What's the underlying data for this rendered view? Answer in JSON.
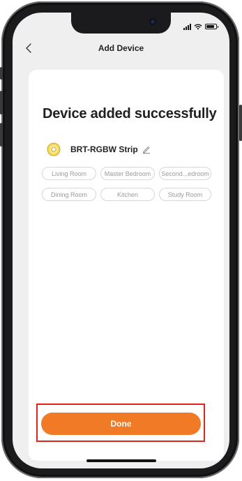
{
  "header": {
    "title": "Add Device",
    "back_icon": "chevron-left-icon"
  },
  "status_bar": {
    "icons": [
      "signal-icon",
      "wifi-icon",
      "battery-icon"
    ]
  },
  "main": {
    "headline": "Device added successfully",
    "device": {
      "name": "BRT-RGBW Strip",
      "icon": "light-strip-icon",
      "edit_icon": "pencil-icon"
    },
    "rooms": [
      "Living Room",
      "Master Bedroom",
      "Second...edroom",
      "Dining Room",
      "Kitchen",
      "Study Room"
    ]
  },
  "footer": {
    "done_label": "Done"
  },
  "colors": {
    "accent": "#f07a26",
    "highlight": "#e2231a",
    "chip_text": "#9a9a9a",
    "chip_border": "#d6d6d6"
  }
}
